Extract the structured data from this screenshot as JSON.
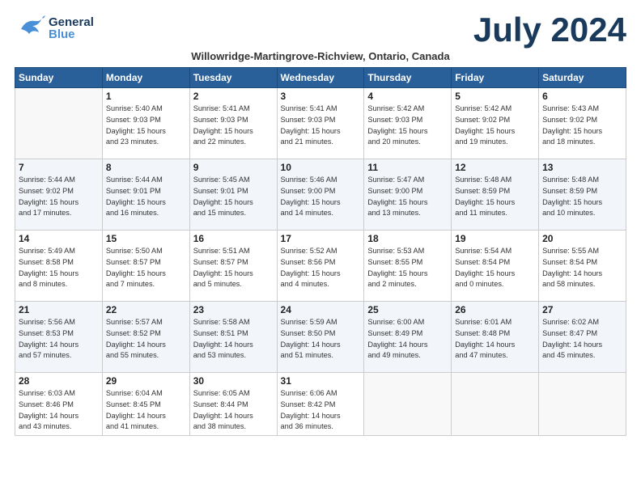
{
  "header": {
    "logo_general": "General",
    "logo_blue": "Blue",
    "month_title": "July 2024",
    "subtitle": "Willowridge-Martingrove-Richview, Ontario, Canada"
  },
  "weekdays": [
    "Sunday",
    "Monday",
    "Tuesday",
    "Wednesday",
    "Thursday",
    "Friday",
    "Saturday"
  ],
  "weeks": [
    [
      {
        "day": "",
        "info": ""
      },
      {
        "day": "1",
        "info": "Sunrise: 5:40 AM\nSunset: 9:03 PM\nDaylight: 15 hours\nand 23 minutes."
      },
      {
        "day": "2",
        "info": "Sunrise: 5:41 AM\nSunset: 9:03 PM\nDaylight: 15 hours\nand 22 minutes."
      },
      {
        "day": "3",
        "info": "Sunrise: 5:41 AM\nSunset: 9:03 PM\nDaylight: 15 hours\nand 21 minutes."
      },
      {
        "day": "4",
        "info": "Sunrise: 5:42 AM\nSunset: 9:03 PM\nDaylight: 15 hours\nand 20 minutes."
      },
      {
        "day": "5",
        "info": "Sunrise: 5:42 AM\nSunset: 9:02 PM\nDaylight: 15 hours\nand 19 minutes."
      },
      {
        "day": "6",
        "info": "Sunrise: 5:43 AM\nSunset: 9:02 PM\nDaylight: 15 hours\nand 18 minutes."
      }
    ],
    [
      {
        "day": "7",
        "info": "Sunrise: 5:44 AM\nSunset: 9:02 PM\nDaylight: 15 hours\nand 17 minutes."
      },
      {
        "day": "8",
        "info": "Sunrise: 5:44 AM\nSunset: 9:01 PM\nDaylight: 15 hours\nand 16 minutes."
      },
      {
        "day": "9",
        "info": "Sunrise: 5:45 AM\nSunset: 9:01 PM\nDaylight: 15 hours\nand 15 minutes."
      },
      {
        "day": "10",
        "info": "Sunrise: 5:46 AM\nSunset: 9:00 PM\nDaylight: 15 hours\nand 14 minutes."
      },
      {
        "day": "11",
        "info": "Sunrise: 5:47 AM\nSunset: 9:00 PM\nDaylight: 15 hours\nand 13 minutes."
      },
      {
        "day": "12",
        "info": "Sunrise: 5:48 AM\nSunset: 8:59 PM\nDaylight: 15 hours\nand 11 minutes."
      },
      {
        "day": "13",
        "info": "Sunrise: 5:48 AM\nSunset: 8:59 PM\nDaylight: 15 hours\nand 10 minutes."
      }
    ],
    [
      {
        "day": "14",
        "info": "Sunrise: 5:49 AM\nSunset: 8:58 PM\nDaylight: 15 hours\nand 8 minutes."
      },
      {
        "day": "15",
        "info": "Sunrise: 5:50 AM\nSunset: 8:57 PM\nDaylight: 15 hours\nand 7 minutes."
      },
      {
        "day": "16",
        "info": "Sunrise: 5:51 AM\nSunset: 8:57 PM\nDaylight: 15 hours\nand 5 minutes."
      },
      {
        "day": "17",
        "info": "Sunrise: 5:52 AM\nSunset: 8:56 PM\nDaylight: 15 hours\nand 4 minutes."
      },
      {
        "day": "18",
        "info": "Sunrise: 5:53 AM\nSunset: 8:55 PM\nDaylight: 15 hours\nand 2 minutes."
      },
      {
        "day": "19",
        "info": "Sunrise: 5:54 AM\nSunset: 8:54 PM\nDaylight: 15 hours\nand 0 minutes."
      },
      {
        "day": "20",
        "info": "Sunrise: 5:55 AM\nSunset: 8:54 PM\nDaylight: 14 hours\nand 58 minutes."
      }
    ],
    [
      {
        "day": "21",
        "info": "Sunrise: 5:56 AM\nSunset: 8:53 PM\nDaylight: 14 hours\nand 57 minutes."
      },
      {
        "day": "22",
        "info": "Sunrise: 5:57 AM\nSunset: 8:52 PM\nDaylight: 14 hours\nand 55 minutes."
      },
      {
        "day": "23",
        "info": "Sunrise: 5:58 AM\nSunset: 8:51 PM\nDaylight: 14 hours\nand 53 minutes."
      },
      {
        "day": "24",
        "info": "Sunrise: 5:59 AM\nSunset: 8:50 PM\nDaylight: 14 hours\nand 51 minutes."
      },
      {
        "day": "25",
        "info": "Sunrise: 6:00 AM\nSunset: 8:49 PM\nDaylight: 14 hours\nand 49 minutes."
      },
      {
        "day": "26",
        "info": "Sunrise: 6:01 AM\nSunset: 8:48 PM\nDaylight: 14 hours\nand 47 minutes."
      },
      {
        "day": "27",
        "info": "Sunrise: 6:02 AM\nSunset: 8:47 PM\nDaylight: 14 hours\nand 45 minutes."
      }
    ],
    [
      {
        "day": "28",
        "info": "Sunrise: 6:03 AM\nSunset: 8:46 PM\nDaylight: 14 hours\nand 43 minutes."
      },
      {
        "day": "29",
        "info": "Sunrise: 6:04 AM\nSunset: 8:45 PM\nDaylight: 14 hours\nand 41 minutes."
      },
      {
        "day": "30",
        "info": "Sunrise: 6:05 AM\nSunset: 8:44 PM\nDaylight: 14 hours\nand 38 minutes."
      },
      {
        "day": "31",
        "info": "Sunrise: 6:06 AM\nSunset: 8:42 PM\nDaylight: 14 hours\nand 36 minutes."
      },
      {
        "day": "",
        "info": ""
      },
      {
        "day": "",
        "info": ""
      },
      {
        "day": "",
        "info": ""
      }
    ]
  ]
}
